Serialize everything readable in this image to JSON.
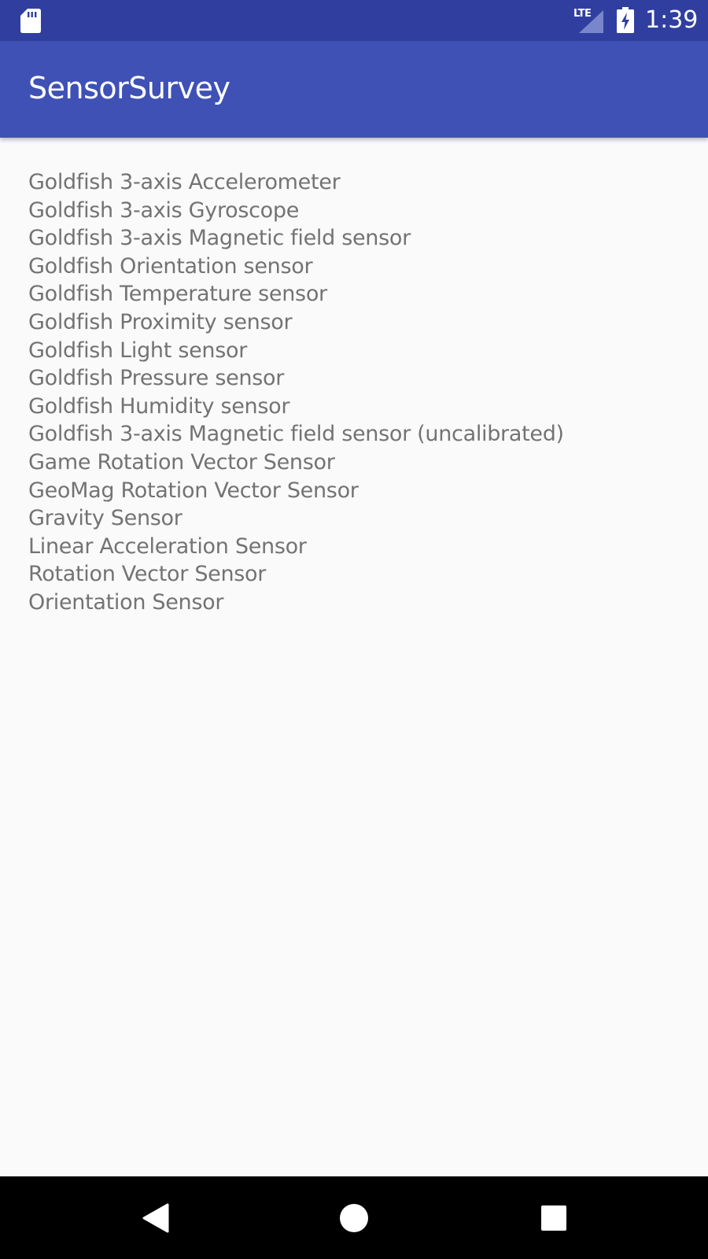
{
  "status_bar": {
    "network_label": "LTE",
    "time": "1:39",
    "icons": [
      "sd-card-icon",
      "signal-icon",
      "battery-charging-icon"
    ]
  },
  "app_bar": {
    "title": "SensorSurvey"
  },
  "sensors": [
    "Goldfish 3-axis Accelerometer",
    "Goldfish 3-axis Gyroscope",
    "Goldfish 3-axis Magnetic field sensor",
    "Goldfish Orientation sensor",
    "Goldfish Temperature sensor",
    "Goldfish Proximity sensor",
    "Goldfish Light sensor",
    "Goldfish Pressure sensor",
    "Goldfish Humidity sensor",
    "Goldfish 3-axis Magnetic field sensor (uncalibrated)",
    "Game Rotation Vector Sensor",
    "GeoMag Rotation Vector Sensor",
    "Gravity Sensor",
    "Linear Acceleration Sensor",
    "Rotation Vector Sensor",
    "Orientation Sensor"
  ],
  "nav_bar": {
    "icons": [
      "back-icon",
      "home-icon",
      "recents-icon"
    ]
  },
  "colors": {
    "status_bar": "#303f9f",
    "app_bar": "#3f51b5",
    "background": "#fafafa",
    "list_text": "#737373",
    "nav_bar": "#000000"
  }
}
